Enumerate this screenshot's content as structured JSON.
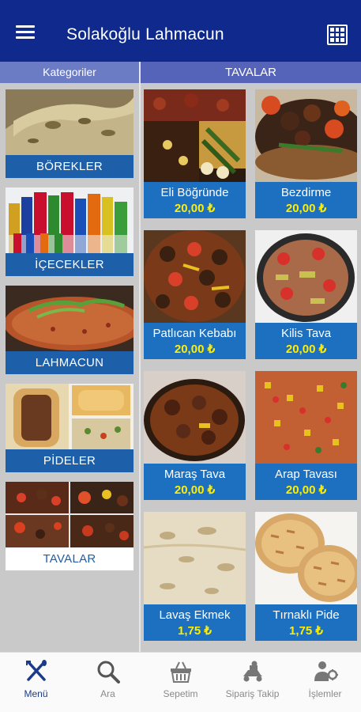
{
  "app": {
    "title": "Solakoğlu Lahmacun"
  },
  "left_panel": {
    "header": "Kategoriler"
  },
  "right_panel": {
    "header": "TAVALAR"
  },
  "categories": [
    {
      "label": "BÖREKLER",
      "active": false
    },
    {
      "label": "İÇECEKLER",
      "active": false
    },
    {
      "label": "LAHMACUN",
      "active": false
    },
    {
      "label": "PİDELER",
      "active": false
    },
    {
      "label": "TAVALAR",
      "active": true
    }
  ],
  "products": [
    {
      "name": "Eli Böğründe",
      "price": "20,00 ₺"
    },
    {
      "name": "Bezdirme",
      "price": "20,00 ₺"
    },
    {
      "name": "Patlıcan Kebabı",
      "price": "20,00 ₺"
    },
    {
      "name": "Kilis Tava",
      "price": "20,00 ₺"
    },
    {
      "name": "Maraş Tava",
      "price": "20,00 ₺"
    },
    {
      "name": "Arap Tavası",
      "price": "20,00 ₺"
    },
    {
      "name": "Lavaş Ekmek",
      "price": "1,75 ₺"
    },
    {
      "name": "Tırnaklı Pide",
      "price": "1,75 ₺"
    }
  ],
  "bottom_nav": [
    {
      "label": "Menü",
      "icon": "fork-knife-icon",
      "active": true
    },
    {
      "label": "Ara",
      "icon": "search-icon",
      "active": false
    },
    {
      "label": "Sepetim",
      "icon": "basket-icon",
      "active": false
    },
    {
      "label": "Sipariş Takip",
      "icon": "delivery-icon",
      "active": false
    },
    {
      "label": "İşlemler",
      "icon": "user-settings-icon",
      "active": false
    }
  ],
  "colors": {
    "appbar": "#0f2a8c",
    "category_label": "#1d5fa8",
    "product_card": "#1d6fc0",
    "price": "#ffee00",
    "panel_background": "#c9c9c9"
  }
}
